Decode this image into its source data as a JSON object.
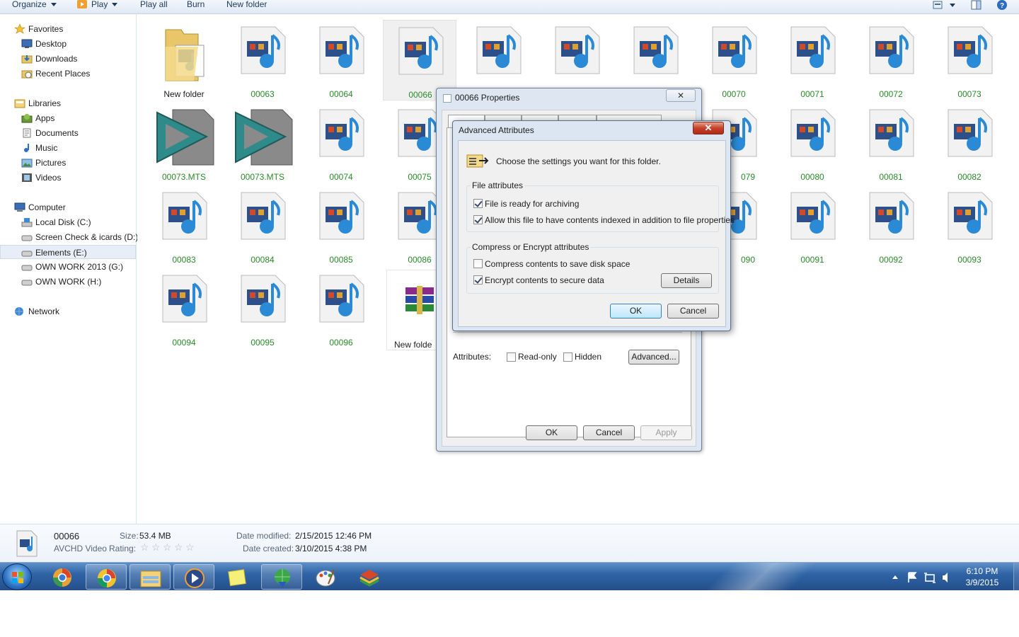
{
  "toolbar": {
    "organize": "Organize",
    "play": "Play",
    "play_all": "Play all",
    "burn": "Burn",
    "new_folder": "New folder"
  },
  "nav": {
    "favorites": "Favorites",
    "desktop": "Desktop",
    "downloads": "Downloads",
    "recent_places": "Recent Places",
    "libraries": "Libraries",
    "apps": "Apps",
    "documents": "Documents",
    "music": "Music",
    "pictures": "Pictures",
    "videos": "Videos",
    "computer": "Computer",
    "local_disk": "Local Disk (C:)",
    "screen_check": "Screen Check & icards (D:)",
    "elements": "Elements (E:)",
    "own_work_g": "OWN WORK 2013 (G:)",
    "own_work_h": "OWN WORK (H:)",
    "network": "Network"
  },
  "files": {
    "r1": [
      "New folder",
      "00063",
      "00064",
      "00066",
      "",
      "",
      "",
      "00070",
      "00071",
      "00072",
      "00073"
    ],
    "r2": [
      "00073.MTS",
      "00073.MTS",
      "00074",
      "00075",
      "079",
      "00080",
      "00081",
      "00082"
    ],
    "r3": [
      "00083",
      "00084",
      "00085",
      "00086",
      "090",
      "00091",
      "00092",
      "00093"
    ],
    "r4": [
      "00094",
      "00095",
      "00096",
      "New folde"
    ]
  },
  "properties": {
    "title": "00066 Properties",
    "close": "✕",
    "attributes_label": "Attributes:",
    "read_only": "Read-only",
    "hidden": "Hidden",
    "advanced": "Advanced...",
    "ok": "OK",
    "cancel": "Cancel",
    "apply": "Apply"
  },
  "advanced": {
    "title": "Advanced Attributes",
    "close": "✕",
    "heading": "Choose the settings you want for this folder.",
    "file_attributes": "File attributes",
    "archiving": "File is ready for archiving",
    "indexed": "Allow this file to have contents indexed in addition to file properties",
    "compress_encrypt": "Compress or Encrypt attributes",
    "compress": "Compress contents to save disk space",
    "encrypt": "Encrypt contents to secure data",
    "details": "Details",
    "ok": "OK",
    "cancel": "Cancel",
    "checked": {
      "archiving": true,
      "indexed": true,
      "compress": false,
      "encrypt": true
    }
  },
  "details": {
    "name": "00066",
    "type": "AVCHD Video",
    "size_label": "Size:",
    "size": "53.4 MB",
    "rating_label": "Rating:",
    "date_modified_label": "Date modified:",
    "date_modified": "2/15/2015 12:46 PM",
    "date_created_label": "Date created:",
    "date_created": "3/10/2015 4:38 PM"
  },
  "taskbar": {
    "time": "6:10 PM",
    "date": "3/9/2015"
  },
  "colors": {
    "file_label": "#2a8a2a",
    "taskbar": "#2f64a6",
    "accent": "#3c7fb1"
  }
}
